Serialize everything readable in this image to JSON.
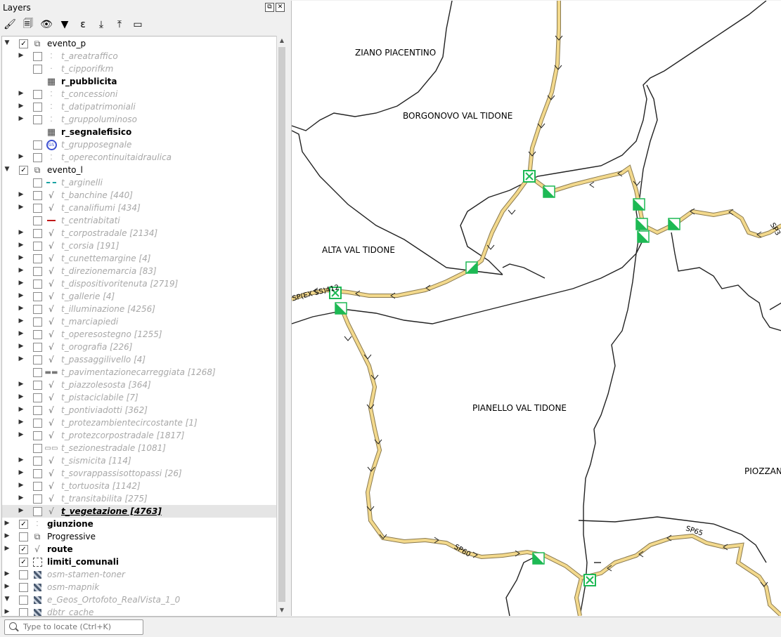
{
  "panel": {
    "title": "Layers",
    "float_symbol": "⧉",
    "close_symbol": "✕"
  },
  "toolbar": [
    {
      "name": "style-manager-icon",
      "glyph": "🖌"
    },
    {
      "name": "add-group-icon",
      "glyph": "🗐"
    },
    {
      "name": "manage-visibility-icon",
      "glyph": "👁"
    },
    {
      "name": "filter-legend-icon",
      "glyph": "▼"
    },
    {
      "name": "filter-expression-icon",
      "glyph": "ε"
    },
    {
      "name": "expand-all-icon",
      "glyph": "⤓"
    },
    {
      "name": "collapse-all-icon",
      "glyph": "⤒"
    },
    {
      "name": "remove-layer-icon",
      "glyph": "▭"
    }
  ],
  "tree": [
    {
      "label": "evento_p",
      "level": 0,
      "expand": "down",
      "checked": true,
      "icon": "group",
      "style": "normal"
    },
    {
      "label": "t_areatraffico",
      "level": 1,
      "expand": "right",
      "checked": false,
      "icon": "points",
      "style": "grey"
    },
    {
      "label": "t_cipporifkm",
      "level": 1,
      "expand": "",
      "checked": false,
      "icon": "dot",
      "style": "grey"
    },
    {
      "label": "r_pubblicita",
      "level": 1,
      "expand": "",
      "checked": null,
      "icon": "table",
      "style": "bold"
    },
    {
      "label": "t_concessioni",
      "level": 1,
      "expand": "right",
      "checked": false,
      "icon": "points",
      "style": "grey"
    },
    {
      "label": "t_datipatrimoniali",
      "level": 1,
      "expand": "right",
      "checked": false,
      "icon": "points",
      "style": "grey"
    },
    {
      "label": "t_gruppoluminoso",
      "level": 1,
      "expand": "right",
      "checked": false,
      "icon": "points",
      "style": "grey"
    },
    {
      "label": "r_segnalefisico",
      "level": 1,
      "expand": "",
      "checked": null,
      "icon": "table",
      "style": "bold"
    },
    {
      "label": "t_grupposegnale",
      "level": 1,
      "expand": "",
      "checked": false,
      "icon": "gs",
      "style": "grey"
    },
    {
      "label": "t_operecontinuitaidraulica",
      "level": 1,
      "expand": "right",
      "checked": false,
      "icon": "points",
      "style": "grey"
    },
    {
      "label": "evento_l",
      "level": 0,
      "expand": "down",
      "checked": true,
      "icon": "group",
      "style": "normal"
    },
    {
      "label": "t_arginelli",
      "level": 1,
      "expand": "",
      "checked": false,
      "icon": "dashline",
      "style": "grey"
    },
    {
      "label": "t_banchine [440]",
      "level": 1,
      "expand": "right",
      "checked": false,
      "icon": "line",
      "style": "grey"
    },
    {
      "label": "t_canalifiumi [434]",
      "level": 1,
      "expand": "right",
      "checked": false,
      "icon": "line",
      "style": "grey"
    },
    {
      "label": "t_centriabitati",
      "level": 1,
      "expand": "",
      "checked": false,
      "icon": "redflag",
      "style": "grey"
    },
    {
      "label": "t_corpostradale [2134]",
      "level": 1,
      "expand": "right",
      "checked": false,
      "icon": "line",
      "style": "grey"
    },
    {
      "label": "t_corsia [191]",
      "level": 1,
      "expand": "right",
      "checked": false,
      "icon": "line",
      "style": "grey"
    },
    {
      "label": "t_cunettemargine [4]",
      "level": 1,
      "expand": "right",
      "checked": false,
      "icon": "line",
      "style": "grey"
    },
    {
      "label": "t_direzionemarcia [83]",
      "level": 1,
      "expand": "right",
      "checked": false,
      "icon": "line",
      "style": "grey"
    },
    {
      "label": "t_dispositivoritenuta [2719]",
      "level": 1,
      "expand": "right",
      "checked": false,
      "icon": "line",
      "style": "grey"
    },
    {
      "label": "t_gallerie [4]",
      "level": 1,
      "expand": "right",
      "checked": false,
      "icon": "line",
      "style": "grey"
    },
    {
      "label": "t_illuminazione [4256]",
      "level": 1,
      "expand": "right",
      "checked": false,
      "icon": "line",
      "style": "grey"
    },
    {
      "label": "t_marciapiedi",
      "level": 1,
      "expand": "right",
      "checked": false,
      "icon": "line",
      "style": "grey"
    },
    {
      "label": "t_operesostegno [1255]",
      "level": 1,
      "expand": "right",
      "checked": false,
      "icon": "line",
      "style": "grey"
    },
    {
      "label": "t_orografia [226]",
      "level": 1,
      "expand": "right",
      "checked": false,
      "icon": "line",
      "style": "grey"
    },
    {
      "label": "t_passaggilivello [4]",
      "level": 1,
      "expand": "right",
      "checked": false,
      "icon": "line",
      "style": "grey"
    },
    {
      "label": "t_pavimentazionecarreggiata [1268]",
      "level": 1,
      "expand": "",
      "checked": false,
      "icon": "pav",
      "style": "grey"
    },
    {
      "label": "t_piazzolesosta [364]",
      "level": 1,
      "expand": "right",
      "checked": false,
      "icon": "line",
      "style": "grey"
    },
    {
      "label": "t_pistaciclabile [7]",
      "level": 1,
      "expand": "right",
      "checked": false,
      "icon": "line",
      "style": "grey"
    },
    {
      "label": "t_pontiviadotti [362]",
      "level": 1,
      "expand": "right",
      "checked": false,
      "icon": "line",
      "style": "grey"
    },
    {
      "label": "t_protezambientecircostante [1]",
      "level": 1,
      "expand": "right",
      "checked": false,
      "icon": "line",
      "style": "grey"
    },
    {
      "label": "t_protezcorpostradale [1817]",
      "level": 1,
      "expand": "right",
      "checked": false,
      "icon": "line",
      "style": "grey"
    },
    {
      "label": "t_sezionestradale [1081]",
      "level": 1,
      "expand": "",
      "checked": false,
      "icon": "sez",
      "style": "grey"
    },
    {
      "label": "t_sismicita [114]",
      "level": 1,
      "expand": "right",
      "checked": false,
      "icon": "line",
      "style": "grey"
    },
    {
      "label": "t_sovrappassisottopassi [26]",
      "level": 1,
      "expand": "right",
      "checked": false,
      "icon": "line",
      "style": "grey"
    },
    {
      "label": "t_tortuosita [1142]",
      "level": 1,
      "expand": "right",
      "checked": false,
      "icon": "line",
      "style": "grey"
    },
    {
      "label": "t_transitabilita [275]",
      "level": 1,
      "expand": "right",
      "checked": false,
      "icon": "line",
      "style": "grey"
    },
    {
      "label": "t_vegetazione [4763]",
      "level": 1,
      "expand": "right",
      "checked": false,
      "icon": "line",
      "style": "selected"
    },
    {
      "label": "giunzione",
      "level": 0,
      "expand": "right",
      "checked": true,
      "icon": "points",
      "style": "bold"
    },
    {
      "label": "Progressive",
      "level": 0,
      "expand": "right",
      "checked": false,
      "icon": "group",
      "style": "normal"
    },
    {
      "label": "route",
      "level": 0,
      "expand": "right",
      "checked": true,
      "icon": "line",
      "style": "bold"
    },
    {
      "label": "limiti_comunali",
      "level": 0,
      "expand": "",
      "checked": true,
      "icon": "polygon",
      "style": "bold"
    },
    {
      "label": "osm-stamen-toner",
      "level": 0,
      "expand": "right",
      "checked": false,
      "icon": "raster",
      "style": "grey"
    },
    {
      "label": "osm-mapnik",
      "level": 0,
      "expand": "right",
      "checked": false,
      "icon": "raster",
      "style": "grey"
    },
    {
      "label": "e_Geos_Ortofoto_RealVista_1_0",
      "level": 0,
      "expand": "down",
      "checked": false,
      "icon": "raster",
      "style": "grey"
    },
    {
      "label": "dbtr_cache",
      "level": 0,
      "expand": "right",
      "checked": false,
      "icon": "raster",
      "style": "grey"
    }
  ],
  "search": {
    "placeholder": "Type to locate (Ctrl+K)"
  },
  "map": {
    "place_labels": [
      "ZIANO PIACENTINO",
      "BORGONOVO VAL TIDONE",
      "ALTA VAL TIDONE",
      "PIANELLO VAL TIDONE",
      "PIOZZAN"
    ],
    "road_labels": [
      "SP(EX SS)412",
      "SP60",
      "SP65",
      "SP3"
    ],
    "colors": {
      "route_fill": "#f3d98c",
      "route_edge": "#8a7a50",
      "marker_green": "#1db954",
      "boundary": "#222222"
    }
  }
}
